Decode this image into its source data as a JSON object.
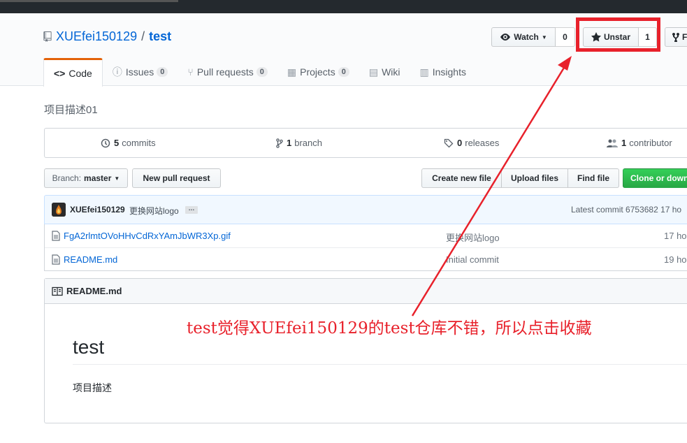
{
  "header": {
    "owner": "XUEfei150129",
    "separator": "/",
    "repo": "test",
    "watch_label": "Watch",
    "watch_count": "0",
    "star_label": "Unstar",
    "star_count": "1",
    "fork_label": "F"
  },
  "tabs": [
    {
      "label": "Code",
      "icon": "code-icon",
      "selected": true
    },
    {
      "label": "Issues",
      "count": "0",
      "icon": "issue-icon"
    },
    {
      "label": "Pull requests",
      "count": "0",
      "icon": "pull-request-icon"
    },
    {
      "label": "Projects",
      "count": "0",
      "icon": "project-icon"
    },
    {
      "label": "Wiki",
      "icon": "book-icon"
    },
    {
      "label": "Insights",
      "icon": "graph-icon"
    }
  ],
  "description": "项目描述01",
  "summary": {
    "commits_count": "5",
    "commits_label": "commits",
    "branch_count": "1",
    "branch_label": "branch",
    "releases_count": "0",
    "releases_label": "releases",
    "contributor_count": "1",
    "contributor_label": "contributor"
  },
  "filebar": {
    "branch_prefix": "Branch:",
    "branch_name": "master",
    "new_pr": "New pull request",
    "create_file": "Create new file",
    "upload": "Upload files",
    "find": "Find file",
    "clone": "Clone or download"
  },
  "commit": {
    "author": "XUEfei150129",
    "message": "更换网站logo",
    "ellipsis": "…",
    "latest": "Latest commit 6753682 17 ho"
  },
  "files": [
    {
      "name": "FgA2rlmtOVoHHvCdRxYAmJbWR3Xp.gif",
      "message": "更换网站logo",
      "age": "17 ho"
    },
    {
      "name": "README.md",
      "message": "Initial commit",
      "age": "19 ho"
    }
  ],
  "readme": {
    "filename": "README.md",
    "heading": "test",
    "body": "项目描述"
  },
  "annotation": {
    "text": "test觉得XUEfei150129的test仓库不错，所以点击收藏",
    "color": "#e8212b"
  },
  "colors": {
    "link": "#0366d6",
    "tab_accent": "#e36209",
    "clone_green": "#28a745",
    "highlight_red": "#e8212b"
  }
}
